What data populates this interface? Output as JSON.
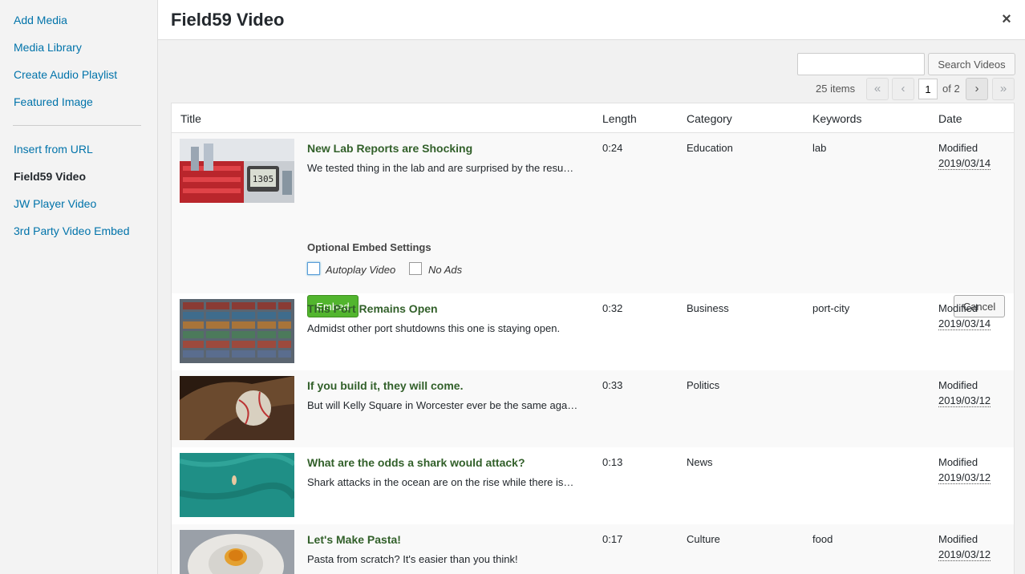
{
  "sidebar": {
    "items": [
      {
        "label": "Add Media"
      },
      {
        "label": "Media Library"
      },
      {
        "label": "Create Audio Playlist"
      },
      {
        "label": "Featured Image"
      },
      {
        "label": "Insert from URL"
      },
      {
        "label": "Field59 Video"
      },
      {
        "label": "JW Player Video"
      },
      {
        "label": "3rd Party Video Embed"
      }
    ]
  },
  "modal": {
    "title": "Field59 Video",
    "close_icon": "×"
  },
  "search": {
    "value": "",
    "button_label": "Search Videos"
  },
  "pagination": {
    "items_count": "25 items",
    "first": "«",
    "prev": "‹",
    "current_page": "1",
    "of_text": "of 2",
    "next": "›",
    "last": "»"
  },
  "table": {
    "headers": {
      "title": "Title",
      "length": "Length",
      "category": "Category",
      "keywords": "Keywords",
      "date": "Date"
    },
    "rows": [
      {
        "title": "New Lab Reports are Shocking",
        "description": "We tested thing in the lab and are surprised by the resu…",
        "length": "0:24",
        "category": "Education",
        "keywords": "lab",
        "date_label": "Modified",
        "date": "2019/03/14",
        "thumb_icon": "lab-timer-thumbnail"
      },
      {
        "title": "This Port Remains Open",
        "description": "Admidst other port shutdowns this one is staying open.",
        "length": "0:32",
        "category": "Business",
        "keywords": "port-city",
        "date_label": "Modified",
        "date": "2019/03/14",
        "thumb_icon": "shipping-containers-thumbnail"
      },
      {
        "title": "If you build it, they will come.",
        "description": "But will Kelly Square in Worcester ever be the same aga…",
        "length": "0:33",
        "category": "Politics",
        "keywords": "",
        "date_label": "Modified",
        "date": "2019/03/12",
        "thumb_icon": "baseball-glove-thumbnail"
      },
      {
        "title": "What are the odds a shark would attack?",
        "description": "Shark attacks in the ocean are on the rise while there is…",
        "length": "0:13",
        "category": "News",
        "keywords": "",
        "date_label": "Modified",
        "date": "2019/03/12",
        "thumb_icon": "ocean-swimmer-thumbnail"
      },
      {
        "title": "Let's Make Pasta!",
        "description": "Pasta from scratch? It's easier than you think!",
        "length": "0:17",
        "category": "Culture",
        "keywords": "food",
        "date_label": "Modified",
        "date": "2019/03/12",
        "thumb_icon": "flour-egg-thumbnail"
      }
    ]
  },
  "embed_settings": {
    "heading": "Optional Embed Settings",
    "autoplay_label": "Autoplay Video",
    "noads_label": "No Ads",
    "embed_label": "Embed",
    "cancel_label": "Cancel"
  },
  "colors": {
    "link": "#0073aa",
    "video_title": "#32602a",
    "embed_button": "#52b52e"
  }
}
